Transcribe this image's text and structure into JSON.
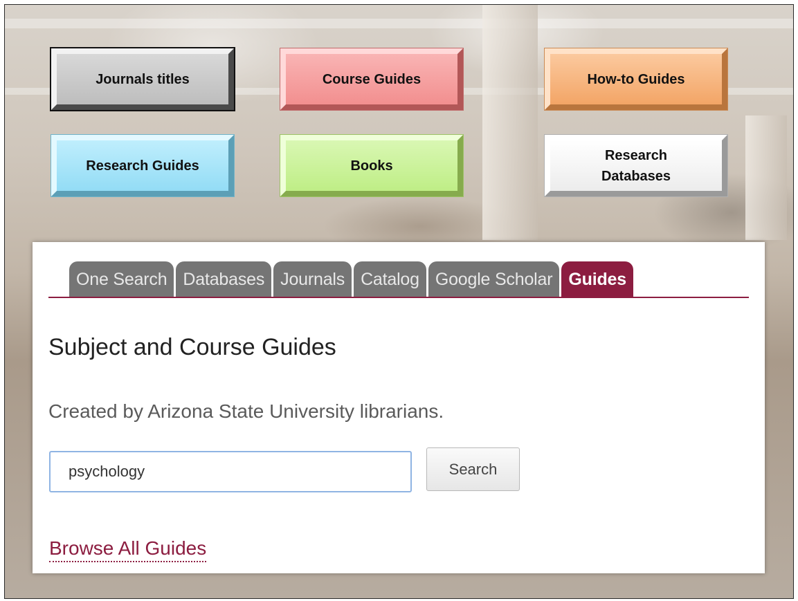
{
  "nav_buttons": {
    "journals": "Journals titles",
    "course": "Course Guides",
    "howto": "How-to Guides",
    "research_guides": "Research Guides",
    "books": "Books",
    "databases": "Research Databases"
  },
  "tabs": [
    {
      "label": "One Search"
    },
    {
      "label": "Databases"
    },
    {
      "label": "Journals"
    },
    {
      "label": "Catalog"
    },
    {
      "label": "Google Scholar"
    },
    {
      "label": "Guides",
      "active": true
    }
  ],
  "panel": {
    "heading": "Subject and Course Guides",
    "subtext": "Created by Arizona State University librarians.",
    "search_value": "psychology",
    "search_button": "Search",
    "browse_link": "Browse All Guides"
  },
  "colors": {
    "accent": "#8c1d40",
    "tab_inactive": "#757575",
    "input_border": "#8fb4e3"
  }
}
